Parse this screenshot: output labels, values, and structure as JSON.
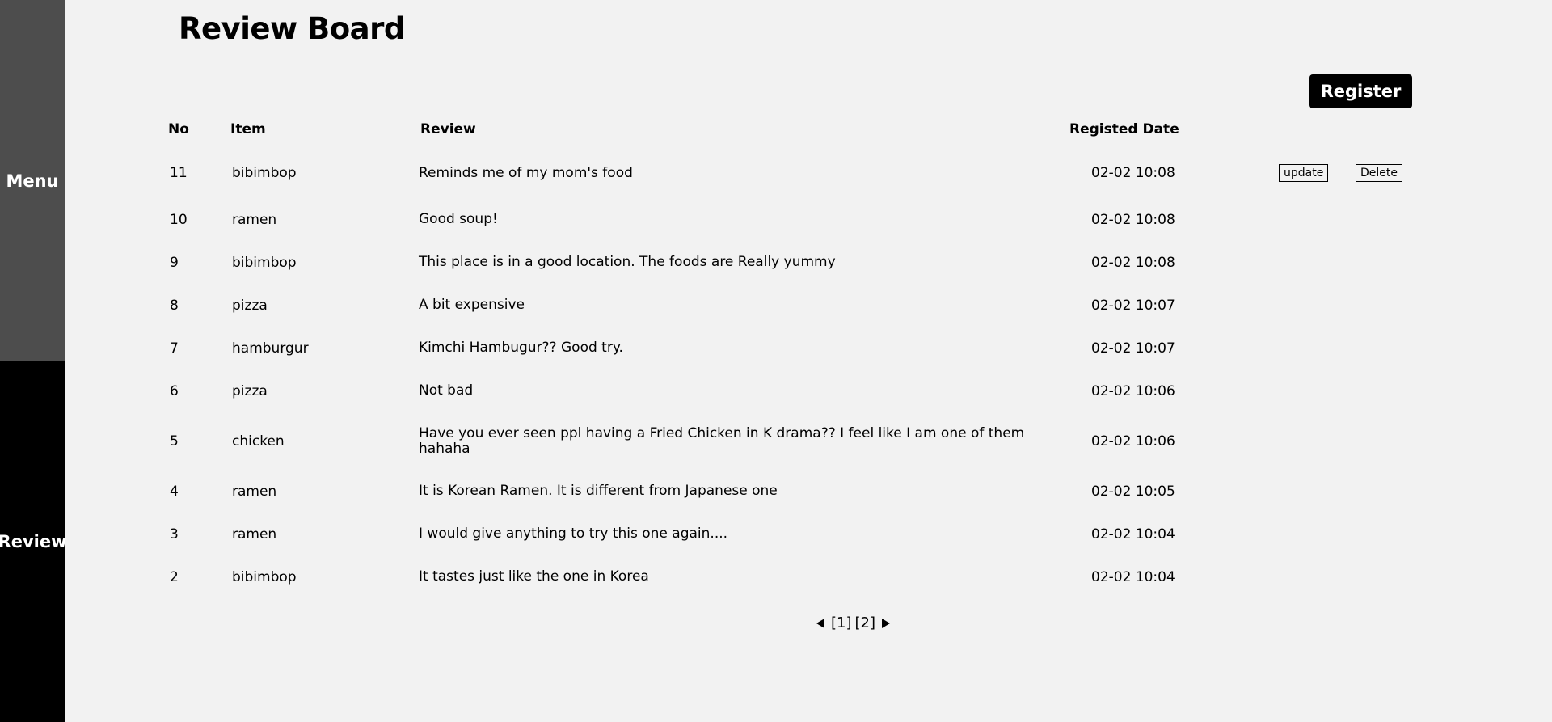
{
  "sidebar": {
    "items": [
      {
        "label": "Menu"
      },
      {
        "label": "Review"
      }
    ]
  },
  "page": {
    "title": "Review Board",
    "register_label": "Register"
  },
  "table": {
    "headers": {
      "no": "No",
      "item": "Item",
      "review": "Review",
      "date": "Registed Date"
    },
    "update_label": "update",
    "delete_label": "Delete",
    "rows": [
      {
        "no": "11",
        "item": "bibimbop",
        "review": "Reminds me of my mom's food",
        "date": "02-02 10:08"
      },
      {
        "no": "10",
        "item": "ramen",
        "review": "Good soup!",
        "date": "02-02 10:08"
      },
      {
        "no": "9",
        "item": "bibimbop",
        "review": "This place is in a good location. The foods are Really yummy",
        "date": "02-02 10:08"
      },
      {
        "no": "8",
        "item": "pizza",
        "review": "A bit expensive",
        "date": "02-02 10:07"
      },
      {
        "no": "7",
        "item": "hamburgur",
        "review": "Kimchi Hambugur?? Good try.",
        "date": "02-02 10:07"
      },
      {
        "no": "6",
        "item": "pizza",
        "review": "Not bad",
        "date": "02-02 10:06"
      },
      {
        "no": "5",
        "item": "chicken",
        "review": "Have you ever seen ppl having a Fried Chicken in K drama?? I feel like I am one of them hahaha",
        "date": "02-02 10:06"
      },
      {
        "no": "4",
        "item": "ramen",
        "review": "It is Korean Ramen. It is different from Japanese one",
        "date": "02-02 10:05"
      },
      {
        "no": "3",
        "item": "ramen",
        "review": "I would give anything to try this one again....",
        "date": "02-02 10:04"
      },
      {
        "no": "2",
        "item": "bibimbop",
        "review": "It tastes just like the one in Korea",
        "date": "02-02 10:04"
      }
    ]
  },
  "pagination": {
    "pages": [
      "[1]",
      "[2]"
    ],
    "prev_icon": "triangle-left-icon",
    "next_icon": "triangle-right-icon"
  },
  "colors": {
    "background": "#f2f2f2",
    "sidebar_menu": "#4d4d4d",
    "sidebar_review": "#000000",
    "register_button": "#000000"
  }
}
